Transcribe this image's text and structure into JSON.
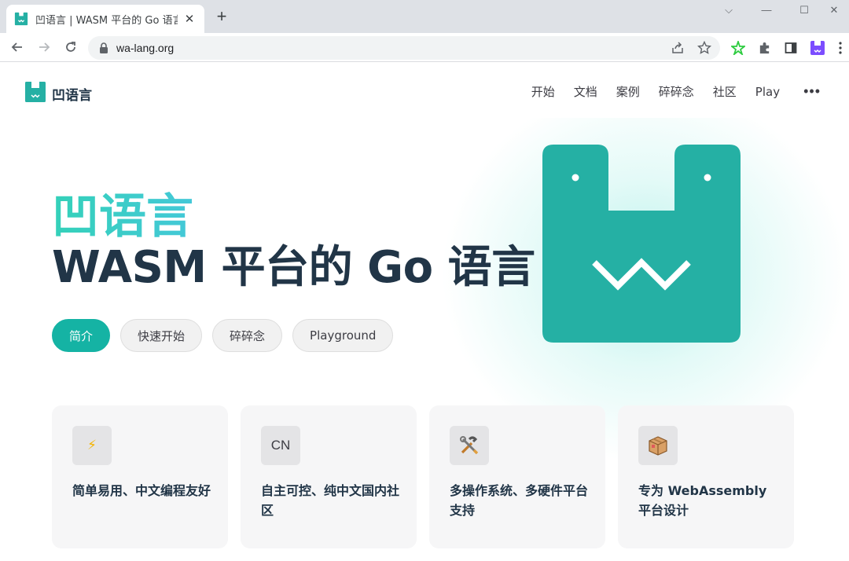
{
  "browser": {
    "tab_title": "凹语言 | WASM 平台的 Go 语言",
    "tab_close": "✕",
    "new_tab": "+",
    "url": "wa-lang.org",
    "window_controls": {
      "minimize": "—",
      "maximize": "☐",
      "close": "✕",
      "tab_search": "⌵"
    }
  },
  "site": {
    "name": "凹语言",
    "nav": [
      "开始",
      "文档",
      "案例",
      "碎碎念",
      "社区",
      "Play"
    ],
    "more": "•••"
  },
  "hero": {
    "name": "凹语言",
    "text": "WASM 平台的 Go 语言",
    "actions": [
      {
        "label": "简介",
        "theme": "brand"
      },
      {
        "label": "快速开始",
        "theme": "alt"
      },
      {
        "label": "碎碎念",
        "theme": "alt"
      },
      {
        "label": "Playground",
        "theme": "alt"
      }
    ]
  },
  "features": [
    {
      "icon": "lightning-icon",
      "icon_text": "⚡",
      "title": "简单易用、中文编程友好"
    },
    {
      "icon": "cn-icon",
      "icon_text": "CN",
      "title": "自主可控、纯中文国内社区"
    },
    {
      "icon": "tools-icon",
      "icon_text": "🛠",
      "title": "多操作系统、多硬件平台支持"
    },
    {
      "icon": "package-icon",
      "icon_text": "📦",
      "title": "专为 WebAssembly 平台设计"
    }
  ],
  "colors": {
    "brand": "#15b3a4",
    "logo": "#25b0a4",
    "text": "#213547",
    "extension_purple": "#7c4dff",
    "extension_green": "#2ecc40"
  }
}
